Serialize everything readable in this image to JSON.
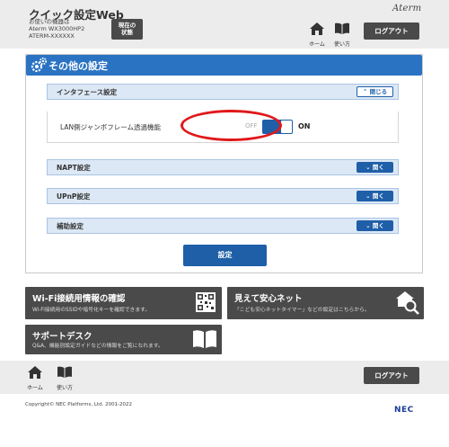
{
  "header": {
    "app_title": "クイック設定Web",
    "device_line1": "お使いの機器は",
    "device_line2": "Aterm WX3000HP2",
    "device_line3": "ATERM-XXXXXX",
    "status_button_line1": "現在の",
    "status_button_line2": "状態",
    "brand": "Aterm",
    "home_label": "ホーム",
    "manual_label": "使い方",
    "logout_label": "ログアウト"
  },
  "panel": {
    "title": "その他の設定",
    "sections": [
      {
        "label": "インタフェース設定",
        "toggle": "閉じる",
        "expanded": true
      },
      {
        "label": "NAPT設定",
        "toggle": "開く",
        "expanded": false
      },
      {
        "label": "UPnP設定",
        "toggle": "開く",
        "expanded": false
      },
      {
        "label": "補助設定",
        "toggle": "開く",
        "expanded": false
      }
    ],
    "jumbo_frame_label": "LAN側ジャンボフレーム透過機能",
    "switch_off_label": "OFF",
    "switch_on_label": "ON",
    "switch_state": "ON",
    "submit_label": "設定"
  },
  "banners": {
    "wifi_title": "Wi-Fi接続用情報の確認",
    "wifi_desc": "Wi-Fi接続用のSSIDや暗号化キーを確認できます。",
    "safety_title": "見えて安心ネット",
    "safety_desc": "「こども安心ネットタイマー」などの設定はこちらから。",
    "support_title": "サポートデスク",
    "support_desc": "Q&A、機能別設定ガイドなどの情報をご覧になれます。"
  },
  "footer": {
    "home_label": "ホーム",
    "manual_label": "使い方",
    "logout_label": "ログアウト",
    "copyright": "Copyright© NEC Platforms, Ltd. 2001-2022",
    "nec_logo": "NEC"
  },
  "colors": {
    "accent_blue": "#1f5fa8",
    "panel_header_blue": "#2a73c3",
    "section_bg": "#dce8f5",
    "dark_button": "#4a4a4a",
    "highlight_red": "#e0191b"
  }
}
